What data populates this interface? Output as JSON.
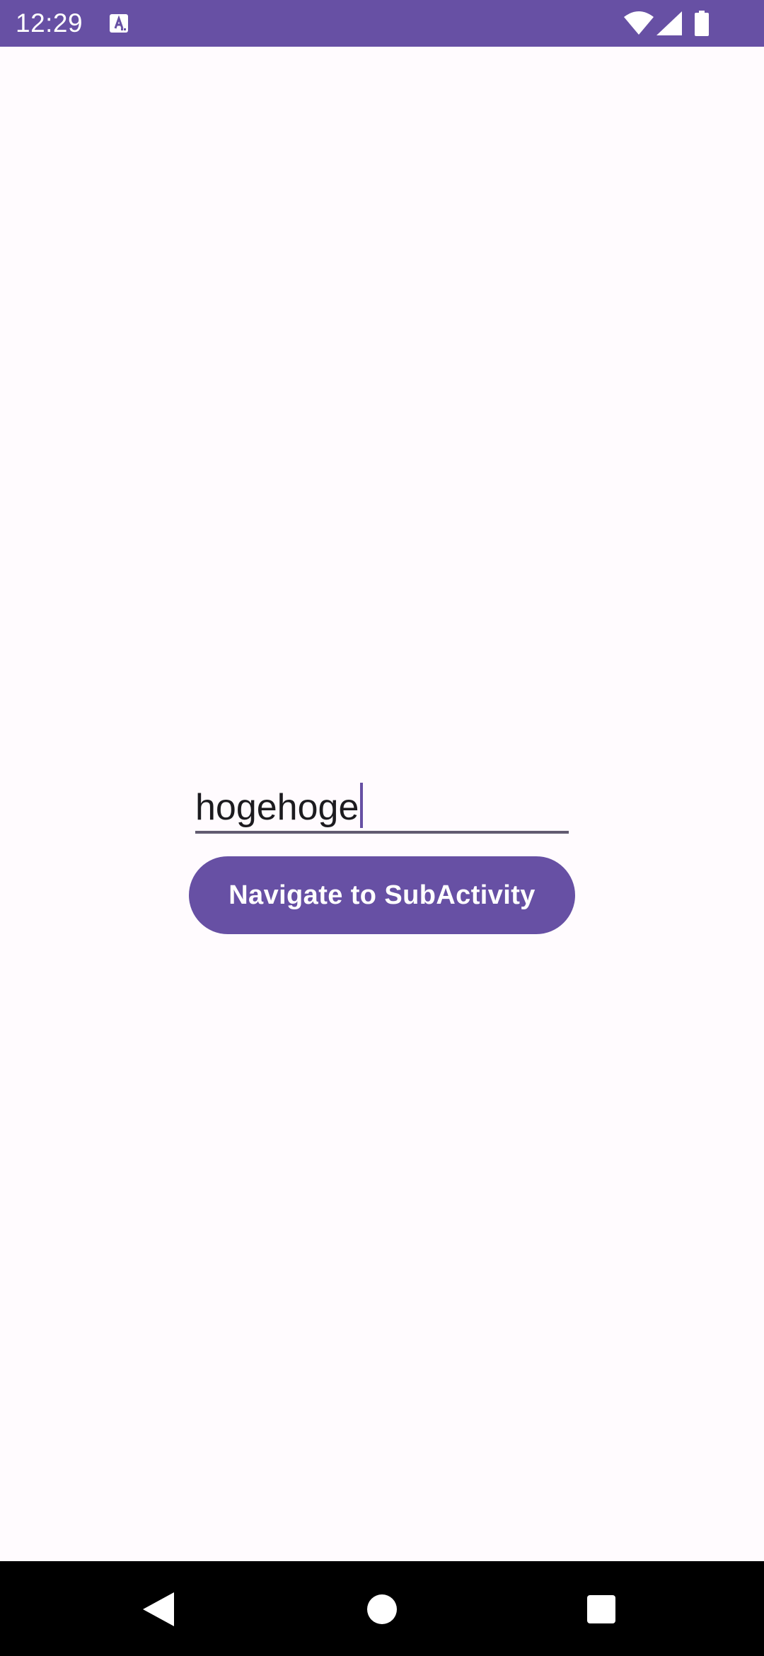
{
  "status_bar": {
    "time": "12:29",
    "app_icon": "font-keyboard-icon",
    "icons": [
      "wifi-icon",
      "signal-icon",
      "battery-icon"
    ],
    "background": "#6750A4"
  },
  "main": {
    "text_field": {
      "value": "hogehoge",
      "focused": true
    },
    "navigate_button": {
      "label": "Navigate to SubActivity"
    }
  },
  "navigation_bar": {
    "buttons": [
      "back",
      "home",
      "recents"
    ]
  },
  "colors": {
    "primary": "#6750A4",
    "background": "#FFFBFE",
    "text": "#1C1B1F"
  }
}
